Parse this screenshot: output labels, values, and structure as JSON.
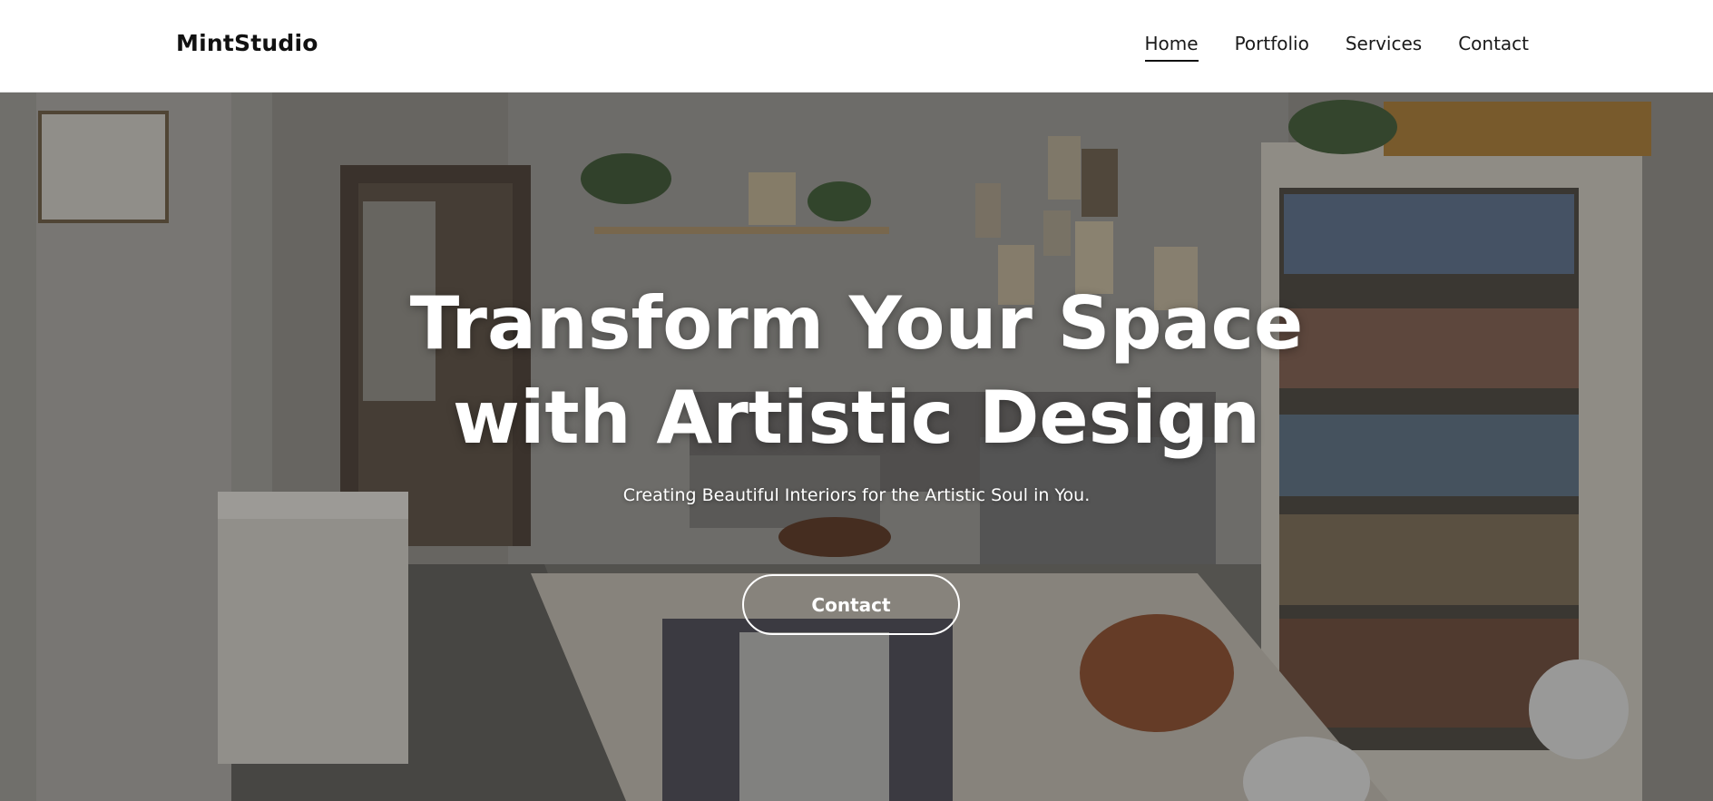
{
  "brand": {
    "name": "MintStudio"
  },
  "nav": {
    "items": [
      {
        "label": "Home",
        "active": true
      },
      {
        "label": "Portfolio",
        "active": false
      },
      {
        "label": "Services",
        "active": false
      },
      {
        "label": "Contact",
        "active": false
      }
    ]
  },
  "hero": {
    "title_line1": "Transform Your Space",
    "title_line2": "with Artistic Design",
    "subtitle": "Creating Beautiful Interiors for the Artistic Soul in You.",
    "cta_label": "Contact",
    "background_image": "living-room-interior-photo"
  },
  "colors": {
    "header_bg": "#ffffff",
    "text_dark": "#111111",
    "hero_text": "#ffffff"
  }
}
